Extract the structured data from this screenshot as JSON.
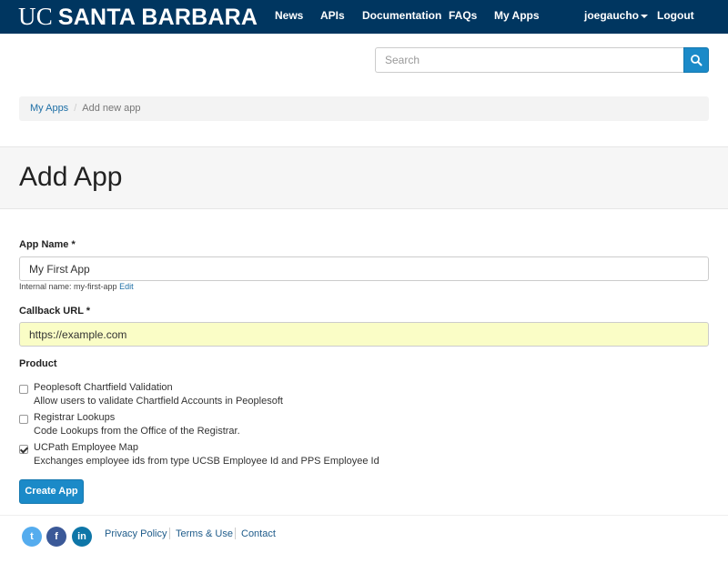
{
  "brand": {
    "uc": "UC",
    "name": "SANTA BARBARA"
  },
  "nav": {
    "news": "News",
    "apis": "APIs",
    "documentation": "Documentation",
    "faqs": "FAQs",
    "my_apps": "My Apps",
    "user": "joegaucho",
    "logout": "Logout"
  },
  "search": {
    "placeholder": "Search",
    "value": ""
  },
  "breadcrumb": {
    "parent": "My Apps",
    "separator": "/",
    "current": "Add new app"
  },
  "page": {
    "title": "Add App"
  },
  "form": {
    "app_name_label": "App Name *",
    "app_name_value": "My First App",
    "internal_name_prefix": "Internal name: my-first-app",
    "internal_name_edit": "Edit",
    "callback_label": "Callback URL *",
    "callback_value": "https://example.com",
    "product_label": "Product",
    "products": [
      {
        "title": "Peoplesoft Chartfield Validation",
        "description": "Allow users to validate Chartfield Accounts in Peoplesoft",
        "checked": false
      },
      {
        "title": "Registrar Lookups",
        "description": "Code Lookups from the Office of the Registrar.",
        "checked": false
      },
      {
        "title": "UCPath Employee Map",
        "description": "Exchanges employee ids from type UCSB Employee Id and PPS Employee Id",
        "checked": true
      }
    ],
    "submit_label": "Create App"
  },
  "footer": {
    "privacy": "Privacy Policy",
    "terms": "Terms & Use",
    "contact": "Contact",
    "social": [
      {
        "icon": "twitter-icon",
        "color": "#55acee",
        "glyph": "t"
      },
      {
        "icon": "facebook-icon",
        "color": "#3b5998",
        "glyph": "f"
      },
      {
        "icon": "linkedin-icon",
        "color": "#0e76a8",
        "glyph": "in"
      }
    ]
  },
  "colors": {
    "navbar": "#003660",
    "primary": "#1b8ac8",
    "link": "#1e6fa6",
    "highlight_field": "#fafdc6"
  }
}
